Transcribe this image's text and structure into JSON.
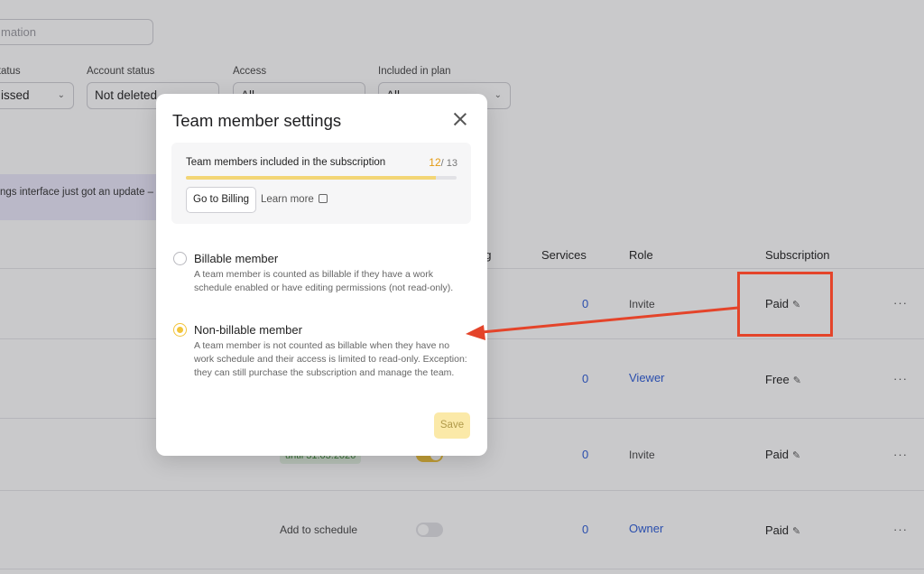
{
  "search": {
    "placeholder": "mation"
  },
  "filters": [
    {
      "label": "status",
      "value": "issed"
    },
    {
      "label": "Account status",
      "value": "Not deleted"
    },
    {
      "label": "Access",
      "value": "All"
    },
    {
      "label": "Included in plan",
      "value": "All"
    }
  ],
  "banner": {
    "text": "ngs interface just got an update –"
  },
  "table": {
    "headers": {
      "col_partial": "ng",
      "services": "Services",
      "role": "Role",
      "subscription": "Subscription"
    },
    "rows": [
      {
        "status": "",
        "services": "0",
        "role": "Invite",
        "role_is_link": false,
        "subscription": "Paid",
        "toggle": null
      },
      {
        "status": "",
        "services": "0",
        "role": "Viewer",
        "role_is_link": true,
        "subscription": "Free",
        "toggle": null
      },
      {
        "status": "until 31.03.2026",
        "services": "0",
        "role": "Invite",
        "role_is_link": false,
        "subscription": "Paid",
        "toggle": "on"
      },
      {
        "status": "Add to schedule",
        "services": "0",
        "role": "Owner",
        "role_is_link": true,
        "subscription": "Paid",
        "toggle": "off"
      }
    ],
    "more_label": "···"
  },
  "modal": {
    "title": "Team member settings",
    "subscription_box": {
      "title": "Team members included in the subscription",
      "used": "12",
      "total": "/ 13",
      "progress": 0.923,
      "billing_button": "Go to Billing",
      "learn_more": "Learn more"
    },
    "options": [
      {
        "title": "Billable member",
        "description": "A team member is counted as billable if they have a work schedule enabled or have editing permissions (not read-only).",
        "checked": false
      },
      {
        "title": "Non-billable member",
        "description": "A team member is not counted as billable when they have no work schedule and their access is limited to read-only. Exception: they can still purchase the subscription and manage the team.",
        "checked": true
      }
    ],
    "save_label": "Save"
  },
  "colors": {
    "accent": "#f2c43a",
    "annotation": "#e4442a",
    "link": "#2b5bd7"
  }
}
